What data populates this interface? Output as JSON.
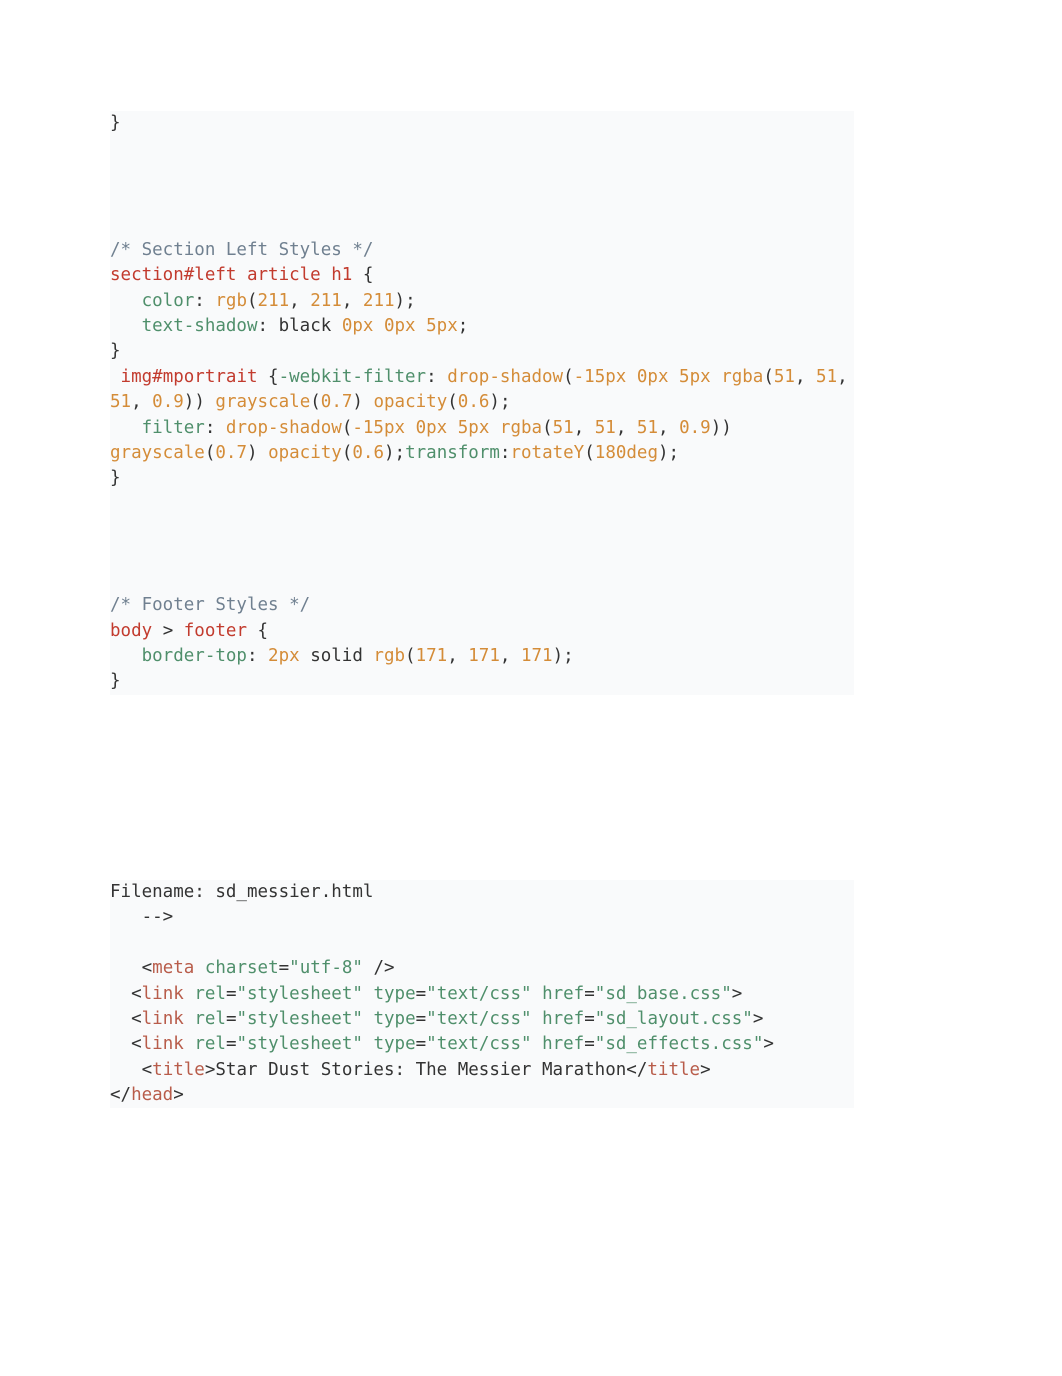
{
  "block1": {
    "l0": "}",
    "l1": "",
    "l2": "",
    "l3": "",
    "l4": "",
    "l5": "/* Section Left Styles */",
    "l6_sel": "section#left article h1",
    "l6_brace": " {",
    "l7_indent": "   ",
    "l7_prop": "color",
    "l7_colon": ": ",
    "l7_func": "rgb",
    "l7_open": "(",
    "l7_a": "211",
    "l7_c1": ", ",
    "l7_b": "211",
    "l7_c2": ", ",
    "l7_c": "211",
    "l7_close": ")",
    "l7_semi": ";",
    "l8_indent": "   ",
    "l8_prop": "text-shadow",
    "l8_colon": ": ",
    "l8_v1": "black ",
    "l8_n1": "0px",
    "l8_s1": " ",
    "l8_n2": "0px",
    "l8_s2": " ",
    "l8_n3": "5px",
    "l8_semi": ";",
    "l9": "}",
    "l10_pre": " ",
    "l10_sel": "img#mportrait",
    "l10_brace": " {",
    "l10_prop": "-webkit-filter",
    "l10_colon": ": ",
    "l10_f1": "drop-shadow",
    "l10_open": "(",
    "l10_a": "-15px",
    "l10_s1": " ",
    "l10_b": "0px",
    "l10_s2": " ",
    "l10_c": "5px",
    "l10_s3": " ",
    "l10_f2": "rgba",
    "l10_o2": "(",
    "l10_rv": "51",
    "l10_c1": ", ",
    "l10_gv": "51",
    "l10_c2": ", ",
    "l10_bv": "51",
    "l10_c3": ", ",
    "l10_av": "0.9",
    "l10_cl2": ")",
    "l10_cl1": ")",
    "l10_sp": " ",
    "l10_f3": "grayscale",
    "l10_o3": "(",
    "l10_gs": "0.7",
    "l10_c3b": ")",
    "l10_sp2": " ",
    "l10_f4": "opacity",
    "l10_o4": "(",
    "l10_op": "0.6",
    "l10_c4": ")",
    "l10_semi": ";",
    "l11_indent": "   ",
    "l11_prop": "filter",
    "l11_colon": ": ",
    "l11_f1": "drop-shadow",
    "l11_o1": "(",
    "l11_a": "-15px",
    "l11_s1": " ",
    "l11_b": "0px",
    "l11_s2": " ",
    "l11_c": "5px",
    "l11_s3": " ",
    "l11_f2": "rgba",
    "l11_o2": "(",
    "l11_rv": "51",
    "l11_c1": ", ",
    "l11_gv": "51",
    "l11_c2": ", ",
    "l11_bv": "51",
    "l11_c3": ", ",
    "l11_av": "0.9",
    "l11_cl2": ")",
    "l11_cl1": ")",
    "l11_sp": " ",
    "l11_f3": "grayscale",
    "l11_o3": "(",
    "l11_gs": "0.7",
    "l11_c3b": ")",
    "l11_sp2": " ",
    "l11_f4": "opacity",
    "l11_o4": "(",
    "l11_op": "0.6",
    "l11_c4": ")",
    "l11_semi1": ";",
    "l11_prop2": "transform",
    "l11_colon2": ":",
    "l11_f5": "rotateY",
    "l11_o5": "(",
    "l11_deg": "180deg",
    "l11_c5": ")",
    "l11_semi2": ";",
    "l12": "}",
    "l13": "",
    "l14": "",
    "l15": "",
    "l16": "",
    "l17": "/* Footer Styles */",
    "l18_s1": "body",
    "l18_gt": " > ",
    "l18_s2": "footer",
    "l18_brace": " {",
    "l19_indent": "   ",
    "l19_prop": "border-top",
    "l19_colon": ": ",
    "l19_n1": "2px",
    "l19_s1": " solid ",
    "l19_func": "rgb",
    "l19_o": "(",
    "l19_a": "171",
    "l19_c1": ", ",
    "l19_b": "171",
    "l19_c2": ", ",
    "l19_c": "171",
    "l19_cl": ")",
    "l19_semi": ";",
    "l20": "}",
    "l21": ""
  },
  "block2": {
    "l0": "Filename: sd_messier.html",
    "l1": "   -->",
    "l2": "",
    "l3_pre": "   <",
    "l3_tag": "meta",
    "l3_sp": " ",
    "l3_attr": "charset",
    "l3_eq": "=",
    "l3_val": "\"utf-8\"",
    "l3_end": " />",
    "link1": {
      "pre": "  <",
      "tag": "link",
      "a1": "rel",
      "v1": "\"stylesheet\"",
      "a2": "type",
      "v2": "\"text/css\"",
      "a3": "href",
      "v3": "\"sd_base.css\"",
      "end": ">"
    },
    "link2": {
      "pre": "  <",
      "tag": "link",
      "a1": "rel",
      "v1": "\"stylesheet\"",
      "a2": "type",
      "v2": "\"text/css\"",
      "a3": "href",
      "v3": "\"sd_layout.css\"",
      "end": ">"
    },
    "link3": {
      "pre": "  <",
      "tag": "link",
      "a1": "rel",
      "v1": "\"stylesheet\"",
      "a2": "type",
      "v2": "\"text/css\"",
      "a3": "href",
      "v3": "\"sd_effects.css\"",
      "end": ">"
    },
    "title": {
      "pre": "   <",
      "tag": "title",
      "gt": ">",
      "text": "Star Dust Stories: The Messier Marathon",
      "lt": "</",
      "endgt": ">"
    },
    "head": {
      "lt": "</",
      "tag": "head",
      "gt": ">"
    }
  }
}
